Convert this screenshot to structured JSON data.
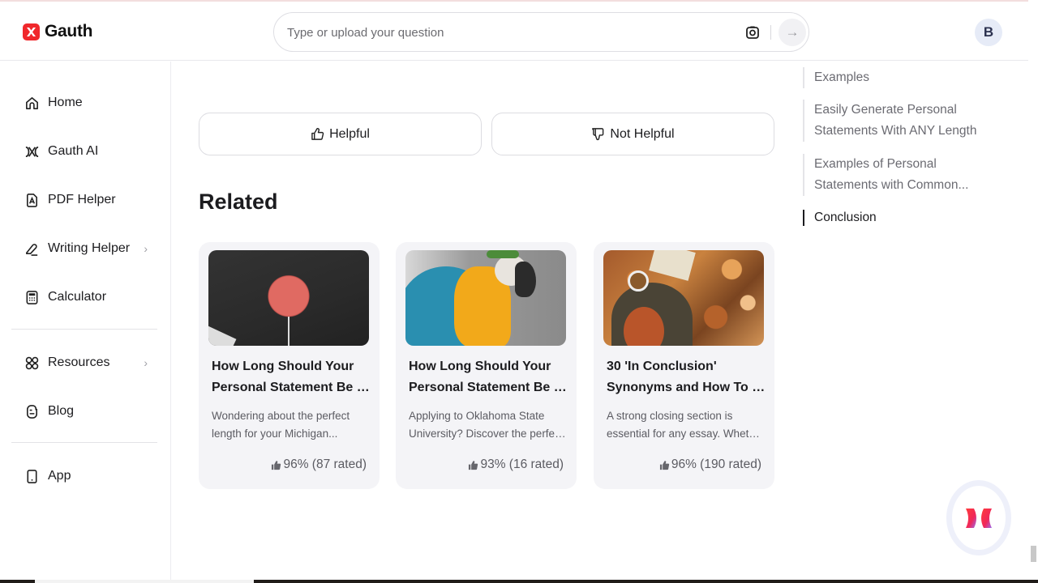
{
  "app": {
    "brand": "Gauth",
    "brand_color": "#f0282c"
  },
  "header": {
    "search_placeholder": "Type or upload your question",
    "camera_icon": "camera-icon",
    "send_icon": "arrow-right-icon",
    "avatar_initial": "B"
  },
  "sidebar": {
    "items": [
      {
        "label": "Home",
        "icon": "home-icon"
      },
      {
        "label": "Gauth AI",
        "icon": "gauth-ai-icon"
      },
      {
        "label": "PDF Helper",
        "icon": "pdf-icon"
      },
      {
        "label": "Writing Helper",
        "icon": "pen-icon",
        "has_submenu": true
      },
      {
        "label": "Calculator",
        "icon": "calculator-icon"
      },
      {
        "label": "Resources",
        "icon": "grid-icon",
        "has_submenu": true
      },
      {
        "label": "Blog",
        "icon": "blog-icon"
      },
      {
        "label": "App",
        "icon": "phone-icon"
      }
    ]
  },
  "feedback": {
    "helpful_label": "Helpful",
    "not_helpful_label": "Not Helpful"
  },
  "related": {
    "title": "Related",
    "cards": [
      {
        "title_line1": "How Long Should Your",
        "title_line2": "Personal Statement Be fo...",
        "desc_line1": "Wondering about the perfect",
        "desc_line2": "length for your Michigan...",
        "rating": "96% (87 rated)",
        "image": "smart-speaker-photo"
      },
      {
        "title_line1": "How Long Should Your",
        "title_line2": "Personal Statement Be fo...",
        "desc_line1": "Applying to Oklahoma State",
        "desc_line2": "University? Discover the perfec...",
        "rating": "93% (16 rated)",
        "image": "parrot-photo"
      },
      {
        "title_line1": "30 'In Conclusion'",
        "title_line2": "Synonyms and How To Us...",
        "desc_line1": "A strong closing section is",
        "desc_line2": "essential for any essay. Whethe...",
        "rating": "96% (190 rated)",
        "image": "autumn-reading-photo"
      }
    ]
  },
  "toc": {
    "items": [
      {
        "line1": "Examples",
        "line2": "",
        "active": false
      },
      {
        "line1": "Easily Generate Personal",
        "line2": "Statements With ANY Length",
        "active": false
      },
      {
        "line1": "Examples of Personal",
        "line2": "Statements with Common...",
        "active": false
      },
      {
        "line1": "Conclusion",
        "line2": "",
        "active": true
      }
    ]
  }
}
